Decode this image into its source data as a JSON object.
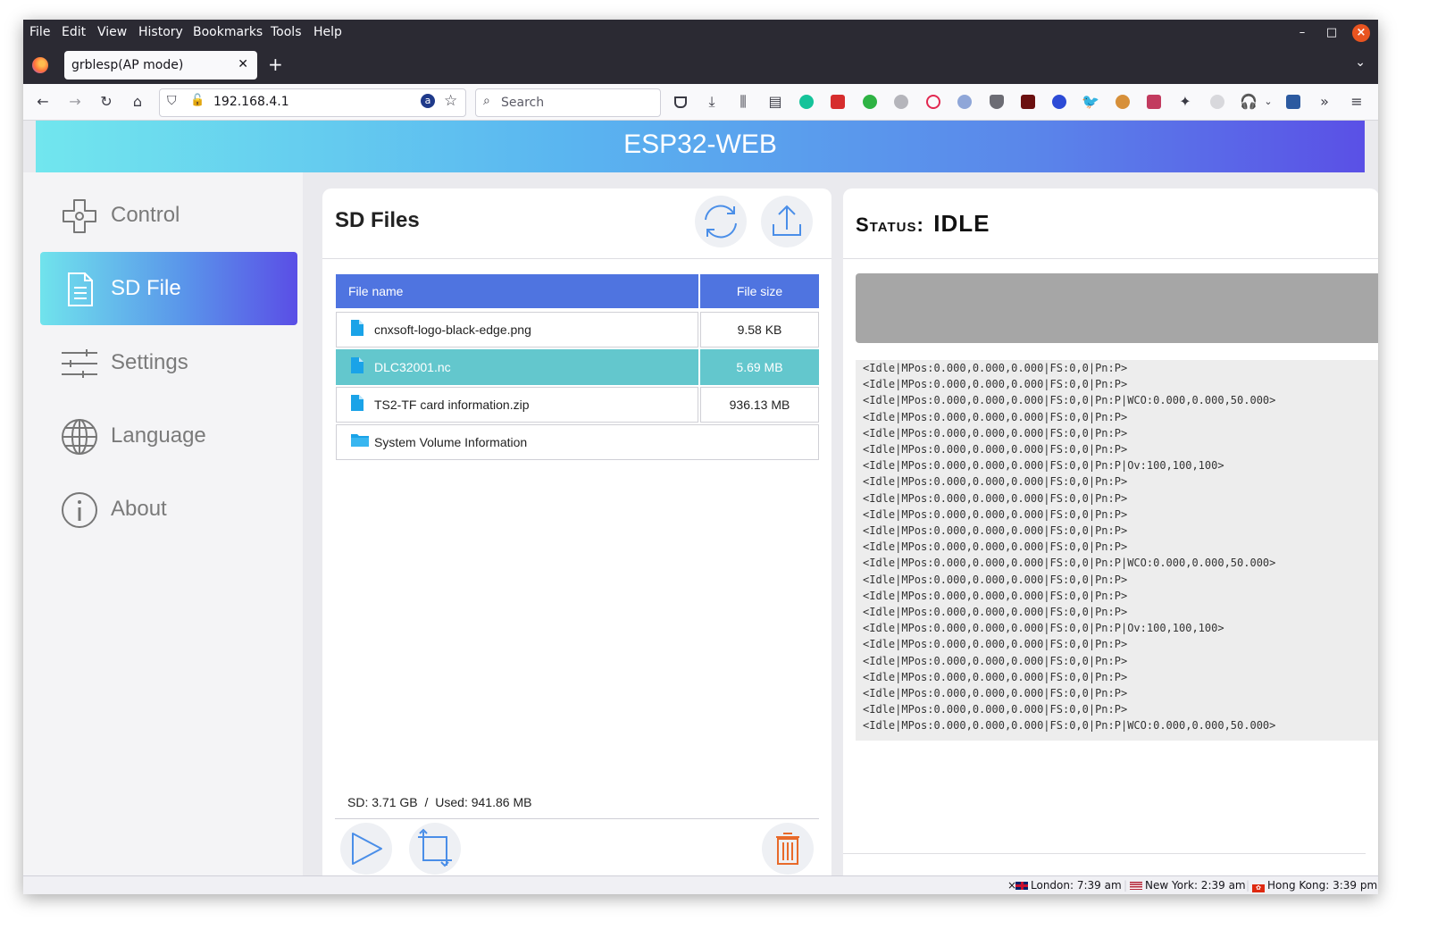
{
  "browser": {
    "menu": [
      "File",
      "Edit",
      "View",
      "History",
      "Bookmarks",
      "Tools",
      "Help"
    ],
    "tab_title": "grblesp(AP mode)",
    "url": "192.168.4.1",
    "search_placeholder": "Search"
  },
  "app": {
    "title": "ESP32-WEB",
    "nav": [
      {
        "label": "Control",
        "icon": "dpad-icon"
      },
      {
        "label": "SD File",
        "icon": "document-icon"
      },
      {
        "label": "Settings",
        "icon": "sliders-icon"
      },
      {
        "label": "Language",
        "icon": "globe-icon"
      },
      {
        "label": "About",
        "icon": "info-icon"
      }
    ],
    "active_nav": "SD File",
    "accent": "#4f74e0",
    "selected_row_color": "#63c7cd"
  },
  "files": {
    "title": "SD Files",
    "columns": [
      "File name",
      "File size"
    ],
    "rows": [
      {
        "name": "cnxsoft-logo-black-edge.png",
        "size": "9.58 KB",
        "type": "file"
      },
      {
        "name": "DLC32001.nc",
        "size": "5.69 MB",
        "type": "file",
        "selected": true
      },
      {
        "name": "TS2-TF card information.zip",
        "size": "936.13 MB",
        "type": "file"
      },
      {
        "name": "System Volume Information",
        "size": "",
        "type": "folder"
      }
    ],
    "sd_total": "SD: 3.71 GB",
    "sd_sep": "/",
    "sd_used": "Used: 941.86 MB"
  },
  "status": {
    "label": "Status:",
    "state": "IDLE",
    "console": [
      "<Idle|MPos:0.000,0.000,0.000|FS:0,0|Pn:P>",
      "<Idle|MPos:0.000,0.000,0.000|FS:0,0|Pn:P>",
      "<Idle|MPos:0.000,0.000,0.000|FS:0,0|Pn:P|WCO:0.000,0.000,50.000>",
      "<Idle|MPos:0.000,0.000,0.000|FS:0,0|Pn:P>",
      "<Idle|MPos:0.000,0.000,0.000|FS:0,0|Pn:P>",
      "<Idle|MPos:0.000,0.000,0.000|FS:0,0|Pn:P>",
      "<Idle|MPos:0.000,0.000,0.000|FS:0,0|Pn:P|Ov:100,100,100>",
      "<Idle|MPos:0.000,0.000,0.000|FS:0,0|Pn:P>",
      "<Idle|MPos:0.000,0.000,0.000|FS:0,0|Pn:P>",
      "<Idle|MPos:0.000,0.000,0.000|FS:0,0|Pn:P>",
      "<Idle|MPos:0.000,0.000,0.000|FS:0,0|Pn:P>",
      "<Idle|MPos:0.000,0.000,0.000|FS:0,0|Pn:P>",
      "<Idle|MPos:0.000,0.000,0.000|FS:0,0|Pn:P|WCO:0.000,0.000,50.000>",
      "<Idle|MPos:0.000,0.000,0.000|FS:0,0|Pn:P>",
      "<Idle|MPos:0.000,0.000,0.000|FS:0,0|Pn:P>",
      "<Idle|MPos:0.000,0.000,0.000|FS:0,0|Pn:P>",
      "<Idle|MPos:0.000,0.000,0.000|FS:0,0|Pn:P|Ov:100,100,100>",
      "<Idle|MPos:0.000,0.000,0.000|FS:0,0|Pn:P>",
      "<Idle|MPos:0.000,0.000,0.000|FS:0,0|Pn:P>",
      "<Idle|MPos:0.000,0.000,0.000|FS:0,0|Pn:P>",
      "<Idle|MPos:0.000,0.000,0.000|FS:0,0|Pn:P>",
      "<Idle|MPos:0.000,0.000,0.000|FS:0,0|Pn:P>",
      "<Idle|MPos:0.000,0.000,0.000|FS:0,0|Pn:P|WCO:0.000,0.000,50.000>"
    ]
  },
  "clocks": [
    {
      "label": "London: 7:39 am"
    },
    {
      "label": "New York: 2:39 am"
    },
    {
      "label": "Hong Kong: 3:39 pm"
    }
  ]
}
